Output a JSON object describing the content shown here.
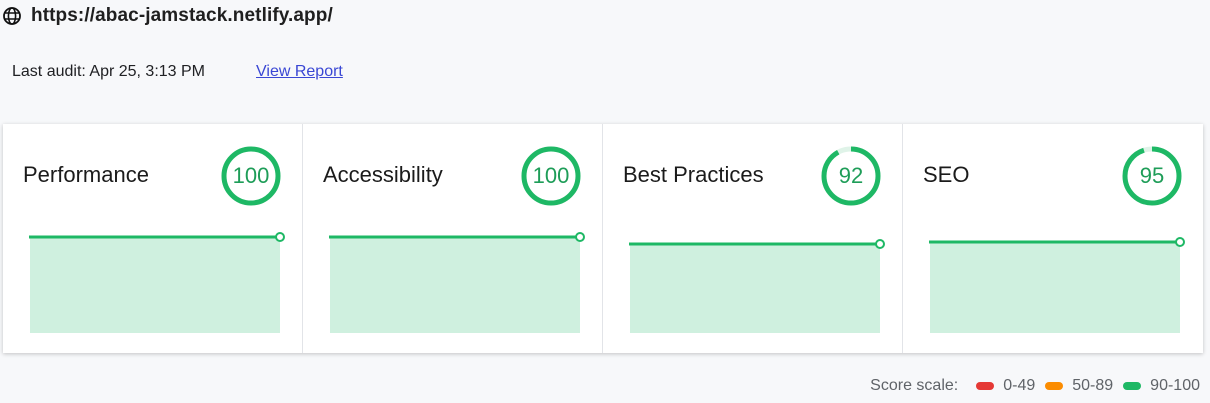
{
  "site": {
    "url": "https://abac-jamstack.netlify.app/",
    "icon": "globe-icon"
  },
  "audit": {
    "last_audit": "Last audit: Apr 25, 3:13 PM",
    "view_report": "View Report"
  },
  "categories": [
    {
      "title": "Performance",
      "score": 100,
      "score_label": "100"
    },
    {
      "title": "Accessibility",
      "score": 100,
      "score_label": "100"
    },
    {
      "title": "Best Practices",
      "score": 92,
      "score_label": "92"
    },
    {
      "title": "SEO",
      "score": 95,
      "score_label": "95"
    }
  ],
  "score_scale": {
    "label": "Score scale:",
    "ranges": [
      {
        "label": "0-49",
        "color": "#e53935"
      },
      {
        "label": "50-89",
        "color": "#fb8c00"
      },
      {
        "label": "90-100",
        "color": "#1eb865"
      }
    ]
  },
  "colors": {
    "good": "#1eb865",
    "good_text": "#1e9d58",
    "good_fill": "#cff0df",
    "gauge_track": "#dff3e8",
    "link": "#3a47d4"
  }
}
